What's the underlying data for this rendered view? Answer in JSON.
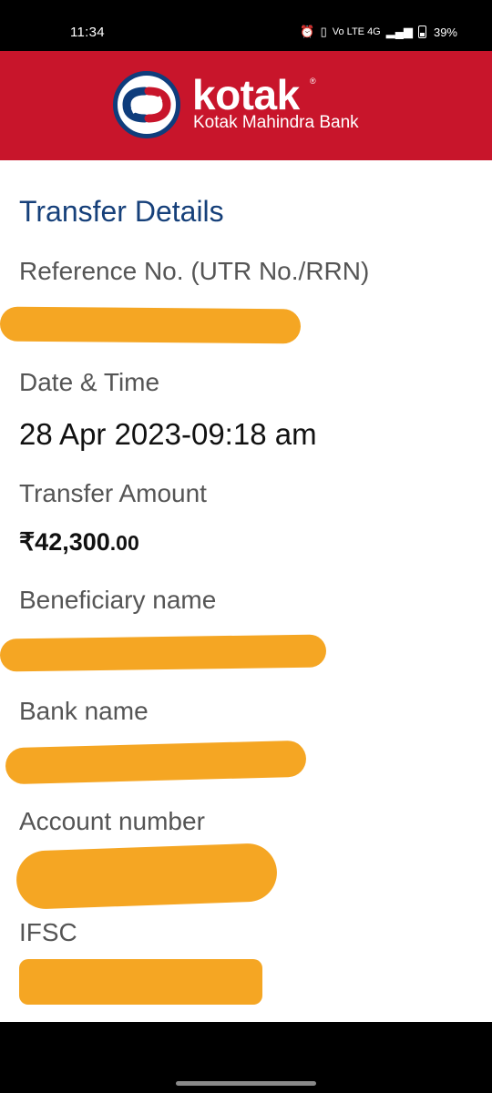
{
  "status_bar": {
    "time": "11:34",
    "network": "Vo LTE  4G",
    "battery": "39%"
  },
  "header": {
    "brand": "kotak",
    "registered": "®",
    "subtitle": "Kotak Mahindra Bank",
    "bg_color": "#c8152b",
    "logo_ring_color": "#0f3d7c"
  },
  "transfer": {
    "title": "Transfer Details",
    "reference_label": "Reference No. (UTR No./RRN)",
    "datetime_label": "Date & Time",
    "datetime_value": "28 Apr 2023-09:18 am",
    "amount_label": "Transfer Amount",
    "amount_main": "₹42,300",
    "amount_decimal": ".00",
    "beneficiary_label": "Beneficiary name",
    "bank_label": "Bank name",
    "account_label": "Account number",
    "ifsc_label": "IFSC"
  },
  "colors": {
    "title": "#16407a",
    "redaction": "#f5a623"
  }
}
